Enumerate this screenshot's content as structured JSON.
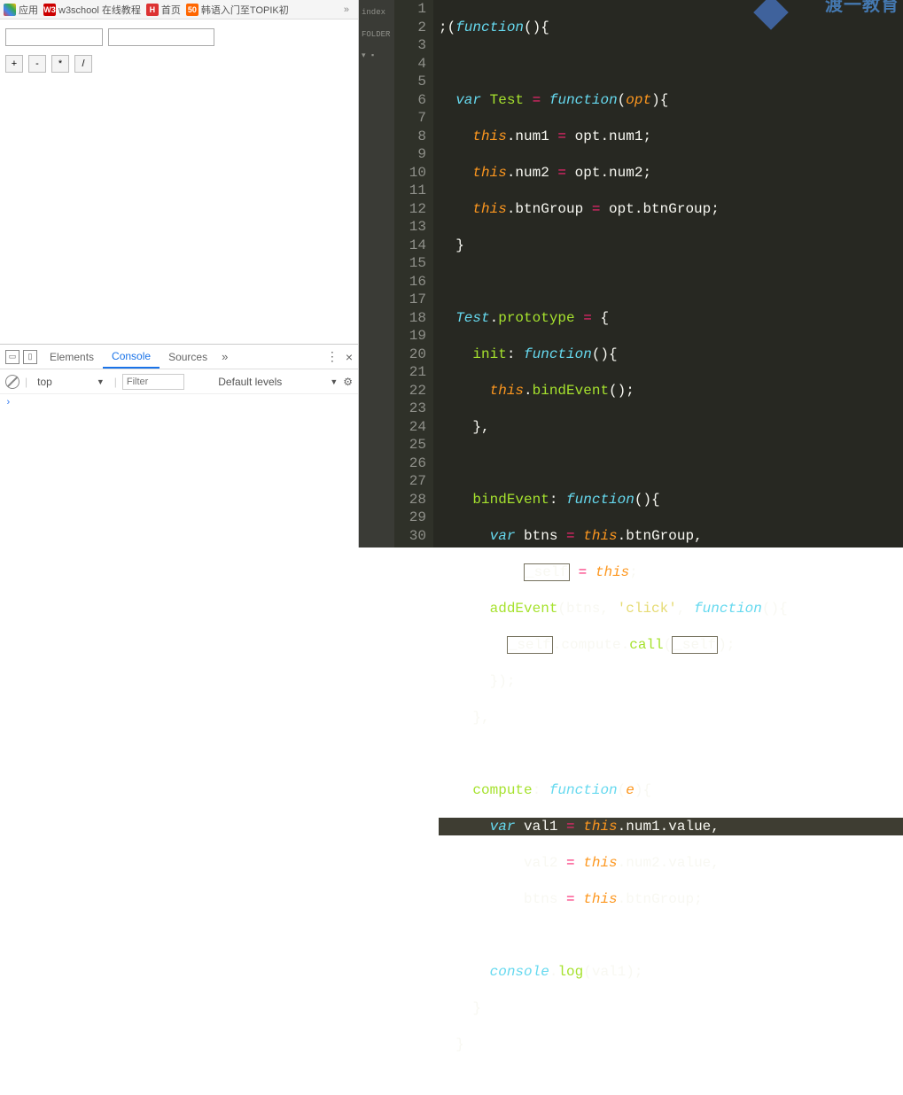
{
  "bookmarks": {
    "apps": "应用",
    "w3": "w3school 在线教程",
    "home": "首页",
    "topik": "韩语入门至TOPIK初",
    "chev": "»"
  },
  "page": {
    "btn1": "+",
    "btn2": "-",
    "btn3": "*",
    "btn4": "/"
  },
  "devtools": {
    "tabs": {
      "elements": "Elements",
      "console": "Console",
      "sources": "Sources",
      "more": "»"
    },
    "close": "×",
    "menu": "⋮",
    "ctx": "top",
    "dd": "▼",
    "filter_ph": "Filter",
    "levels": "Default levels",
    "prompt": "›"
  },
  "sidecol": {
    "index": "index",
    "folder": "FOLDER"
  },
  "watermark": "渡一教育",
  "code_lines": [
    1,
    2,
    3,
    4,
    5,
    6,
    7,
    8,
    9,
    10,
    11,
    12,
    13,
    14,
    15,
    16,
    17,
    18,
    19,
    20,
    21,
    22,
    23,
    24,
    25,
    26,
    27,
    28,
    29,
    30
  ],
  "code": {
    "l1_a": ";(",
    "l1_b": "function",
    "l1_c": "(){",
    "l3_a": "var",
    "l3_b": " ",
    "l3_ent": "Test",
    "l3_c": " ",
    "l3_op": "=",
    "l3_d": " ",
    "l3_fn": "function",
    "l3_e": "(",
    "l3_p": "opt",
    "l3_f": "){",
    "l4_a": "this",
    "l4_b": ".num1 ",
    "l4_op": "=",
    "l4_c": " opt.num1;",
    "l5_a": "this",
    "l5_b": ".num2 ",
    "l5_op": "=",
    "l5_c": " opt.num2;",
    "l6_a": "this",
    "l6_b": ".btnGroup ",
    "l6_op": "=",
    "l6_c": " opt.btnGroup;",
    "l7": "}",
    "l9_a": "Test",
    "l9_b": ".",
    "l9_c": "prototype",
    "l9_d": " ",
    "l9_op": "=",
    "l9_e": " {",
    "l10_a": "init",
    "l10_b": ": ",
    "l10_fn": "function",
    "l10_c": "(){",
    "l11_a": "this",
    "l11_b": ".",
    "l11_call": "bindEvent",
    "l11_c": "();",
    "l12": "},",
    "l14_a": "bindEvent",
    "l14_b": ": ",
    "l14_fn": "function",
    "l14_c": "(){",
    "l15_a": "var",
    "l15_b": " btns ",
    "l15_op": "=",
    "l15_c": " ",
    "l15_this": "this",
    "l15_d": ".btnGroup,",
    "l16_a": "_self",
    "l16_b": " ",
    "l16_op": "=",
    "l16_c": " ",
    "l16_this": "this",
    "l16_d": ";",
    "l17_call": "addEvent",
    "l17_a": "(btns, ",
    "l17_str": "'click'",
    "l17_b": ", ",
    "l17_fn": "function",
    "l17_c": "(){",
    "l18_a": "_self",
    "l18_b": ".compute.",
    "l18_call": "call",
    "l18_c": "(",
    "l18_d": "_self",
    "l18_e": ");",
    "l19": "});",
    "l20": "},",
    "l22_a": "compute",
    "l22_b": ": ",
    "l22_fn": "function",
    "l22_c": "(",
    "l22_p": "e",
    "l22_d": "){",
    "l23_a": "var",
    "l23_b": " val1 ",
    "l23_op": "=",
    "l23_c": " ",
    "l23_this": "this",
    "l23_d": ".num1.value,",
    "l24_a": "val2 ",
    "l24_op": "=",
    "l24_b": " ",
    "l24_this": "this",
    "l24_c": ".num2.value,",
    "l25_a": "btns ",
    "l25_op": "=",
    "l25_b": " ",
    "l25_this": "this",
    "l25_c": ".btnGroup;",
    "l27_a": "console",
    "l27_b": ".",
    "l27_call": "log",
    "l27_c": "(val1);",
    "l28": "}",
    "l29": "}"
  }
}
